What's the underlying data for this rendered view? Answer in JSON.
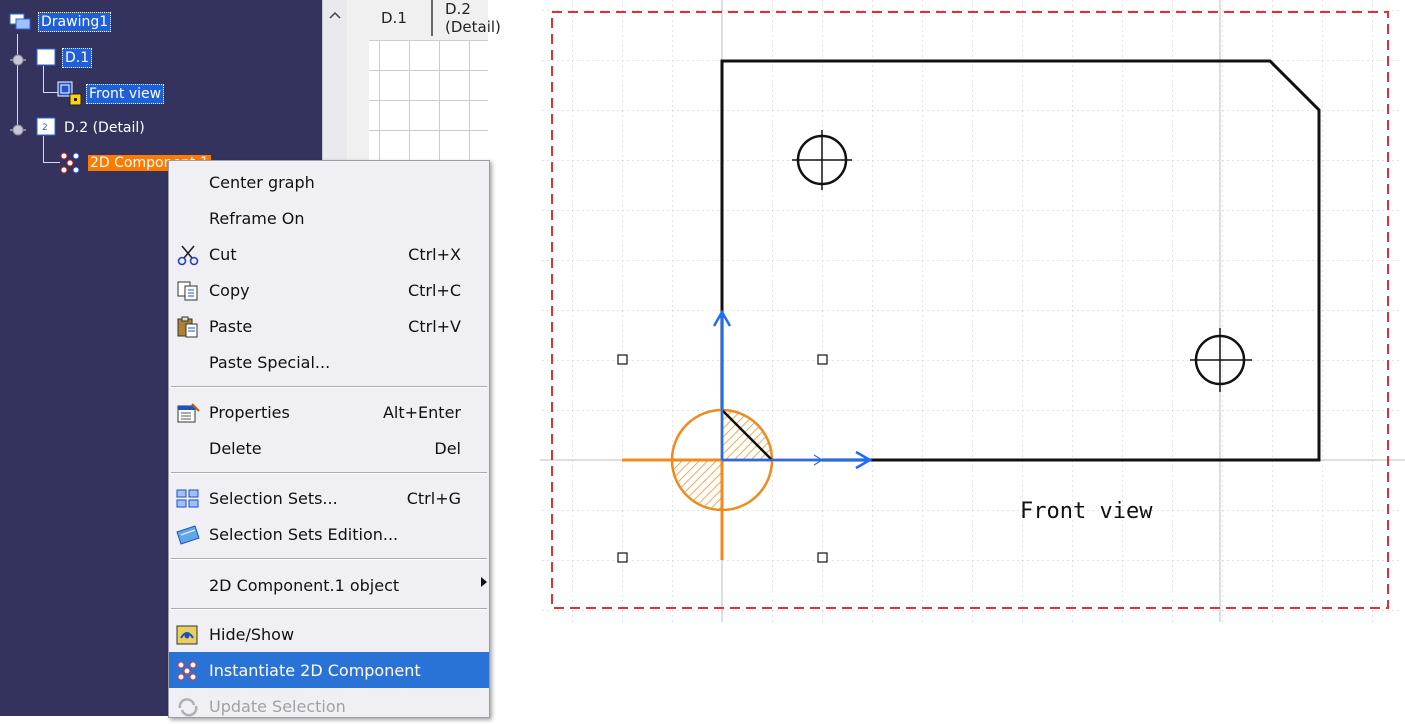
{
  "tree": {
    "root": "Drawing1",
    "sheet1": "D.1",
    "front_view": "Front view",
    "sheet2": "D.2 (Detail)",
    "component": "2D Component.1"
  },
  "sheet_tabs": [
    "D.1",
    "D.2 (Detail)"
  ],
  "context_menu": {
    "items": [
      {
        "label": "Center graph",
        "shortcut": "",
        "icon": "none"
      },
      {
        "label": "Reframe On",
        "shortcut": "",
        "icon": "none"
      },
      {
        "label": "Cut",
        "shortcut": "Ctrl+X",
        "icon": "scissors-icon"
      },
      {
        "label": "Copy",
        "shortcut": "Ctrl+C",
        "icon": "copy-icon"
      },
      {
        "label": "Paste",
        "shortcut": "Ctrl+V",
        "icon": "paste-icon"
      },
      {
        "label": "Paste Special...",
        "shortcut": "",
        "icon": "none"
      },
      {
        "label": "Properties",
        "shortcut": "Alt+Enter",
        "icon": "properties-icon"
      },
      {
        "label": "Delete",
        "shortcut": "Del",
        "icon": "none"
      },
      {
        "label": "Selection Sets...",
        "shortcut": "Ctrl+G",
        "icon": "selection-sets-icon"
      },
      {
        "label": "Selection Sets Edition...",
        "shortcut": "",
        "icon": "selection-sets-edition-icon"
      },
      {
        "label": "2D Component.1 object",
        "shortcut": "",
        "icon": "none",
        "submenu": true
      },
      {
        "label": "Hide/Show",
        "shortcut": "",
        "icon": "hide-show-icon"
      },
      {
        "label": "Instantiate 2D Component",
        "shortcut": "",
        "icon": "instantiate-icon",
        "selected": true
      },
      {
        "label": "Update Selection",
        "shortcut": "",
        "icon": "update-icon",
        "disabled": true
      }
    ]
  },
  "drawing": {
    "view_label": "Front view",
    "colors": {
      "frame": "#e03030",
      "outline": "#111111",
      "axis": "#1e6cff",
      "component": "#f08a1c",
      "grid": "#c8c8c8"
    }
  }
}
